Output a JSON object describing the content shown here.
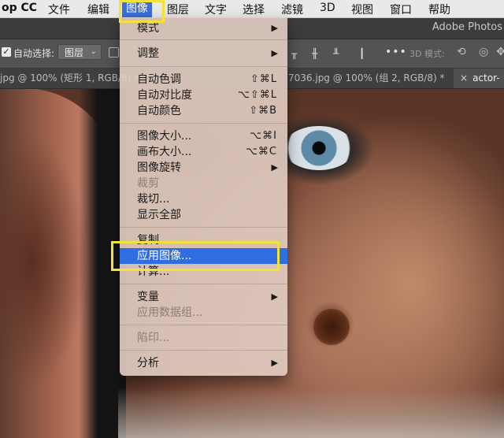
{
  "menubar": {
    "app": "op CC",
    "items": [
      "文件",
      "编辑",
      "图像",
      "图层",
      "文字",
      "选择",
      "滤镜",
      "3D",
      "视图",
      "窗口",
      "帮助"
    ]
  },
  "titlebar": {
    "app_title": "Adobe Photos"
  },
  "options_bar": {
    "auto_select_checked": true,
    "auto_select_label": "自动选择:",
    "layer_select_value": "图层",
    "three_d_mode_label": "3D 模式:",
    "more_icon": "more-horizontal-icon"
  },
  "document_tabs": [
    {
      "label": "jpg @ 100% (矩形 1, RGB/8) *"
    },
    {
      "label": "7036.jpg @ 100% (组 2, RGB/8) *"
    },
    {
      "label": "actor-",
      "close": "×"
    }
  ],
  "image_menu": {
    "items": [
      {
        "label": "模式",
        "submenu": true
      },
      {
        "label": "调整",
        "submenu": true
      },
      {
        "label": "自动色调",
        "shortcut": "⇧⌘L"
      },
      {
        "label": "自动对比度",
        "shortcut": "⌥⇧⌘L"
      },
      {
        "label": "自动颜色",
        "shortcut": "⇧⌘B"
      },
      {
        "label": "图像大小...",
        "shortcut": "⌥⌘I"
      },
      {
        "label": "画布大小...",
        "shortcut": "⌥⌘C"
      },
      {
        "label": "图像旋转",
        "submenu": true
      },
      {
        "label": "裁剪",
        "disabled": true
      },
      {
        "label": "裁切..."
      },
      {
        "label": "显示全部"
      },
      {
        "label": "复制..."
      },
      {
        "label": "应用图像...",
        "highlighted": true
      },
      {
        "label": "计算..."
      },
      {
        "label": "变量",
        "submenu": true
      },
      {
        "label": "应用数据组...",
        "disabled": true
      },
      {
        "label": "陷印...",
        "disabled": true
      },
      {
        "label": "分析",
        "submenu": true
      }
    ]
  },
  "colors": {
    "menu_highlight": "#2f6ee0",
    "annotation_box": "#f2e23a"
  }
}
